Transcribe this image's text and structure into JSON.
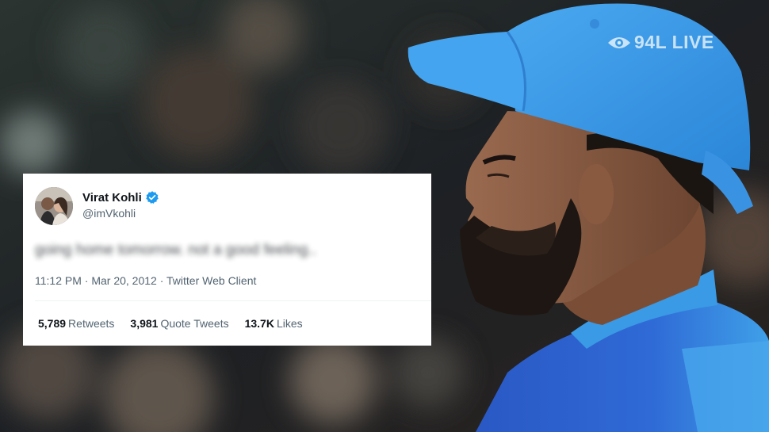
{
  "overlay": {
    "live_badge": "94L LIVE",
    "live_icon": "eye-icon"
  },
  "tweet": {
    "display_name": "Virat Kohli",
    "verified_icon": "verified-badge-icon",
    "handle": "@imVkohli",
    "text": "going home tomorrow. not a good feeling..",
    "timestamp": "11:12 PM · Mar 20, 2012",
    "source": "Twitter Web Client",
    "stats": [
      {
        "value": "5,789",
        "label": "Retweets"
      },
      {
        "value": "3,981",
        "label": "Quote Tweets"
      },
      {
        "value": "13.7K",
        "label": "Likes"
      }
    ]
  },
  "colors": {
    "cap_blue": "#3a9ae6",
    "jersey_blue": "#2f6ad6",
    "verified_blue": "#1d9bf0",
    "text_primary": "#0f1419",
    "text_secondary": "#536471"
  }
}
